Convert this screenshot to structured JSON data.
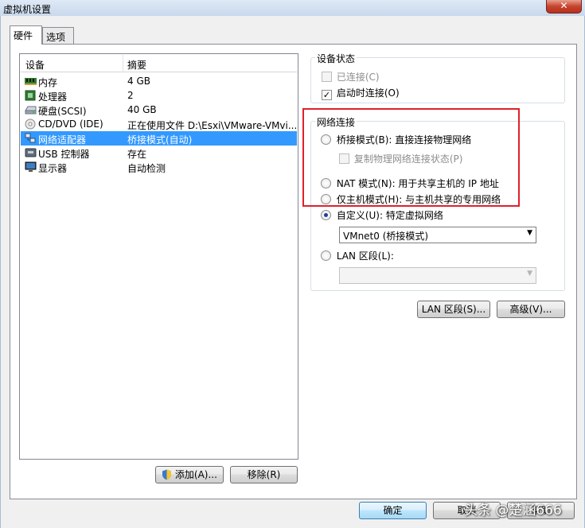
{
  "window": {
    "title": "虚拟机设置",
    "close_glyph": "✕"
  },
  "tabs": [
    {
      "label": "硬件"
    },
    {
      "label": "选项"
    }
  ],
  "device_list": {
    "col_device": "设备",
    "col_summary": "摘要",
    "rows": [
      {
        "device": "内存",
        "summary": "4 GB",
        "icon": "memory-icon"
      },
      {
        "device": "处理器",
        "summary": "2",
        "icon": "processor-icon"
      },
      {
        "device": "硬盘(SCSI)",
        "summary": "40 GB",
        "icon": "harddisk-icon"
      },
      {
        "device": "CD/DVD (IDE)",
        "summary": "正在使用文件 D:\\Esxi\\VMware-VMvi...",
        "icon": "cd-dvd-icon"
      },
      {
        "device": "网络适配器",
        "summary": "桥接模式(自动)",
        "icon": "network-adapter-icon",
        "selected": true
      },
      {
        "device": "USB 控制器",
        "summary": "存在",
        "icon": "usb-icon"
      },
      {
        "device": "显示器",
        "summary": "自动检测",
        "icon": "monitor-icon"
      }
    ]
  },
  "list_buttons": {
    "add": "添加(A)...",
    "remove": "移除(R)"
  },
  "device_status": {
    "title": "设备状态",
    "connected": {
      "label": "已连接(C)",
      "checked": false,
      "disabled": true
    },
    "connect_on_start": {
      "label": "启动时连接(O)",
      "checked": true,
      "checkmark": "✓"
    }
  },
  "network": {
    "title": "网络连接",
    "bridged": "桥接模式(B): 直接连接物理网络",
    "replicate": "复制物理网络连接状态(P)",
    "nat": "NAT 模式(N): 用于共享主机的 IP 地址",
    "host_only": "仅主机模式(H): 与主机共享的专用网络",
    "custom": "自定义(U): 特定虚拟网络",
    "custom_selected": "VMnet0 (桥接模式)",
    "lan_segment": "LAN 区段(L):",
    "lan_segment_selected": "",
    "dropdown_glyph": "▼"
  },
  "net_buttons": {
    "lan_segments": "LAN 区段(S)...",
    "advanced": "高级(V)..."
  },
  "footer": {
    "ok": "确定",
    "cancel": "取消",
    "help": "帮助"
  },
  "watermark": "头条 @楚涵666",
  "colors": {
    "selection": "#3399ff",
    "highlight_box": "#e0202a"
  }
}
